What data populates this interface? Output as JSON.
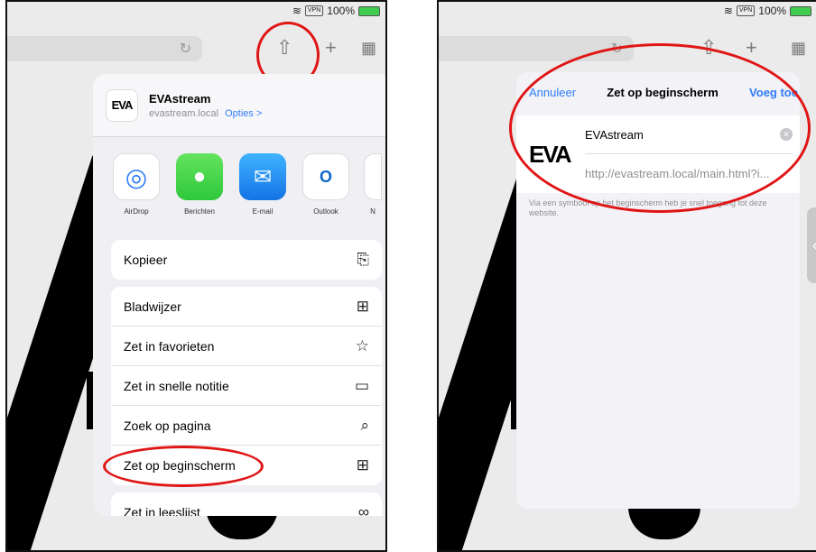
{
  "status": {
    "vpn": "VPN",
    "battery": "100%"
  },
  "left": {
    "header": {
      "title": "EVAstream",
      "subtitle": "evastream.local",
      "options": "Opties >",
      "logo": "EVA"
    },
    "apps": [
      {
        "label": "AirDrop",
        "icon": "airdrop-icon"
      },
      {
        "label": "Berichten",
        "icon": "messages-icon"
      },
      {
        "label": "E-mail",
        "icon": "mail-icon"
      },
      {
        "label": "Outlook",
        "icon": "outlook-icon"
      },
      {
        "label": "N",
        "icon": "notes-icon"
      }
    ],
    "actions": [
      {
        "label": "Kopieer",
        "icon": "copy-icon"
      },
      {
        "label": "Bladwijzer",
        "icon": "book-icon"
      },
      {
        "label": "Zet in favorieten",
        "icon": "star-icon"
      },
      {
        "label": "Zet in snelle notitie",
        "icon": "quick-note-icon"
      },
      {
        "label": "Zoek op pagina",
        "icon": "search-icon"
      },
      {
        "label": "Zet op beginscherm",
        "icon": "add-square-icon"
      },
      {
        "label": "Zet in leeslijst",
        "icon": "glasses-icon"
      }
    ]
  },
  "right": {
    "nav": {
      "cancel": "Annuleer",
      "title": "Zet op beginscherm",
      "add": "Voeg toe"
    },
    "name_value": "EVAstream",
    "url": "http://evastream.local/main.html?i...",
    "hint": "Via een symbool op het beginscherm heb je snel toegang tot deze website.",
    "logo": "EVA"
  },
  "colors": {
    "accent": "#2f7cf6",
    "highlight": "#e01616"
  }
}
